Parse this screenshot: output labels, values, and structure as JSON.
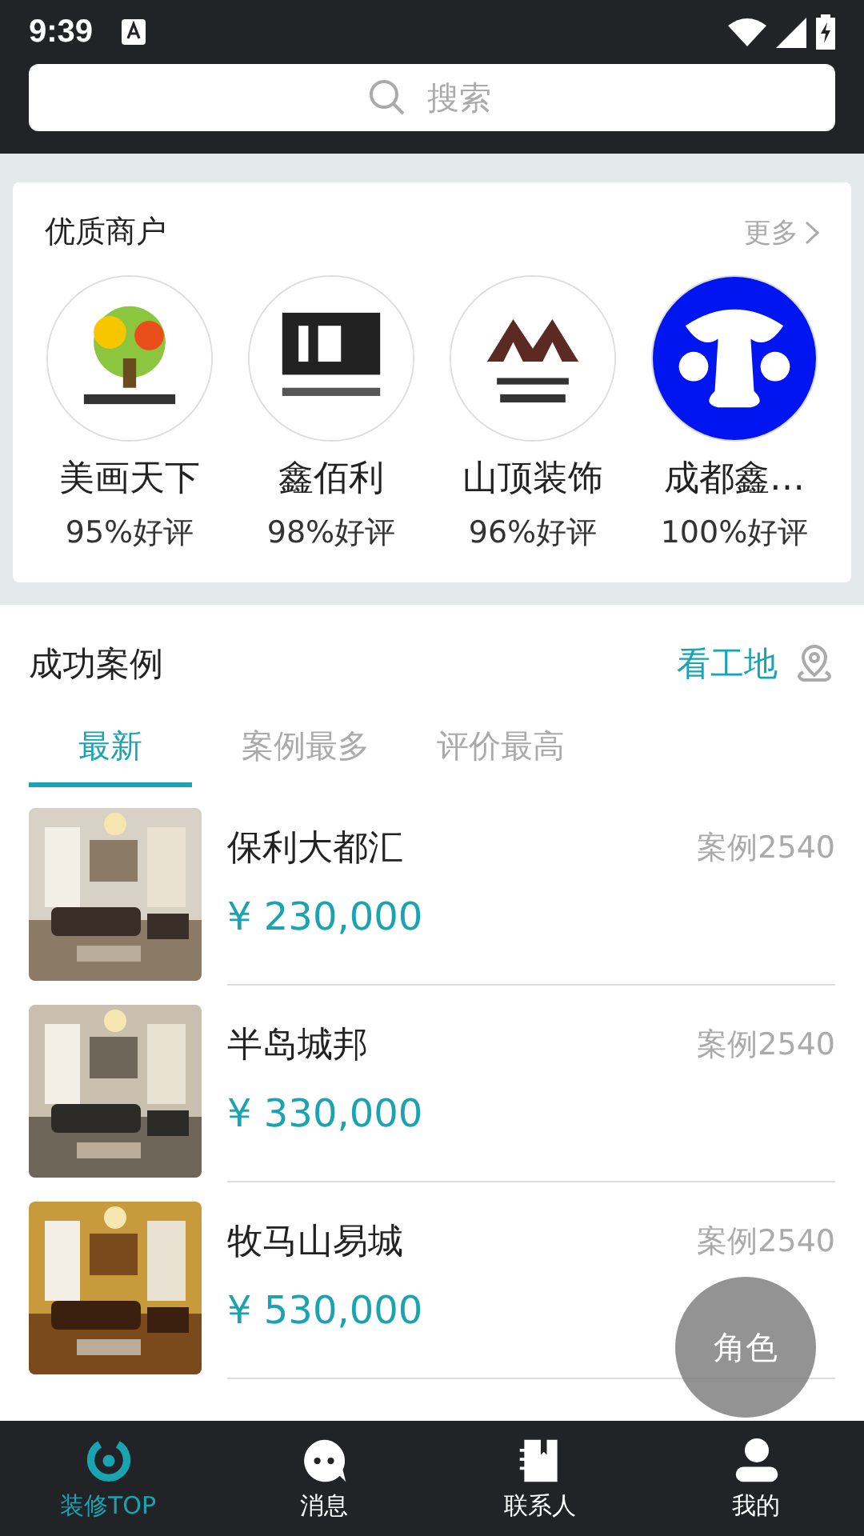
{
  "status_bar": {
    "time": "9:39"
  },
  "search": {
    "placeholder": "搜索"
  },
  "merchants": {
    "title": "优质商户",
    "more": "更多",
    "items": [
      {
        "name": "美画天下",
        "rating": "95%好评"
      },
      {
        "name": "鑫佰利",
        "rating": "98%好评"
      },
      {
        "name": "山顶装饰",
        "rating": "96%好评"
      },
      {
        "name": "成都鑫…",
        "rating": "100%好评"
      }
    ]
  },
  "cases": {
    "title": "成功案例",
    "site_link": "看工地",
    "tabs": [
      {
        "label": "最新",
        "selected": true
      },
      {
        "label": "案例最多",
        "selected": false
      },
      {
        "label": "评价最高",
        "selected": false
      }
    ],
    "items": [
      {
        "name": "保利大都汇",
        "price": "¥ 230,000",
        "count": "案例2540"
      },
      {
        "name": "半岛城邦",
        "price": "¥ 330,000",
        "count": "案例2540"
      },
      {
        "name": "牧马山易城",
        "price": "¥ 530,000",
        "count": "案例2540"
      }
    ]
  },
  "fab": {
    "label": "角色"
  },
  "nav": [
    {
      "label": "装修TOP",
      "selected": true
    },
    {
      "label": "消息",
      "selected": false
    },
    {
      "label": "联系人",
      "selected": false
    },
    {
      "label": "我的",
      "selected": false
    }
  ]
}
